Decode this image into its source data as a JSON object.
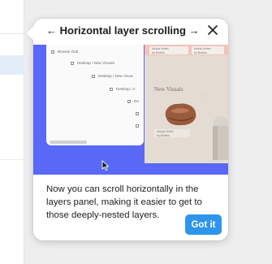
{
  "popover": {
    "title": "← Horizontal layer scrolling →",
    "body": "Now you can scroll horizontally in the layers panel, making it easier to get to those deeply-nested layers.",
    "button_label": "Got it",
    "accent_color": "#2d95ec",
    "illustration_bg": "#5a68f6"
  },
  "illustration": {
    "layers": [
      {
        "label": "Browse Grid"
      },
      {
        "label": "Desktop / New Visuals"
      },
      {
        "label": "Desktop / New Visua"
      },
      {
        "label": "Desktop / A"
      },
      {
        "label": "De"
      }
    ],
    "canvas_heading": "New Visuals",
    "canvas_card_title": "Aesop Notes",
    "canvas_card_sub": "by Bodies"
  },
  "icons": {
    "close": "close-icon",
    "cursor": "mouse-cursor-icon"
  }
}
